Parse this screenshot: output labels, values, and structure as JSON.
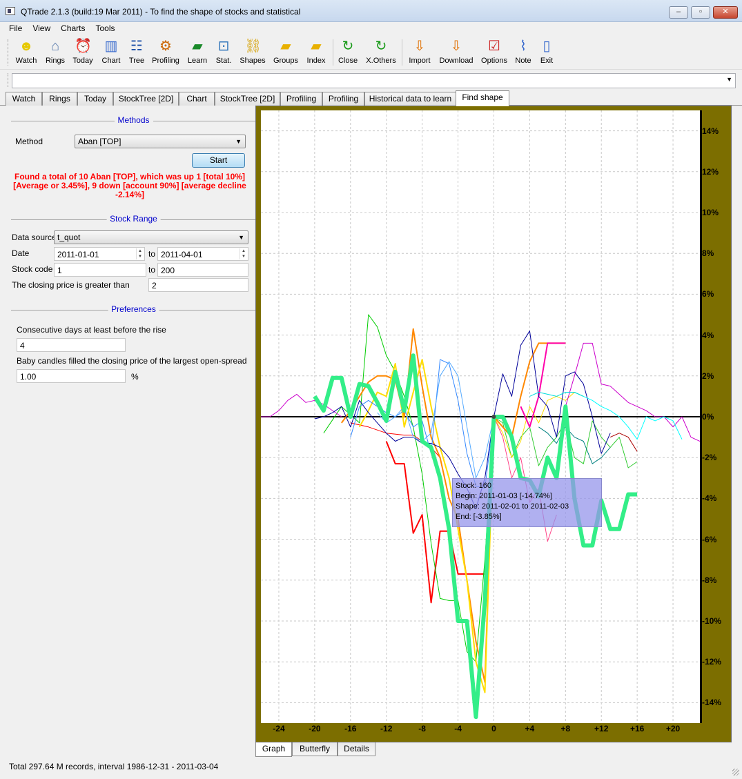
{
  "window": {
    "title": "QTrade 2.1.3 (build:19 Mar 2011) - To find the shape of stocks and statistical"
  },
  "menu": [
    "File",
    "View",
    "Charts",
    "Tools"
  ],
  "toolbar": [
    {
      "label": "Watch",
      "icon": "smiley-icon"
    },
    {
      "label": "Rings",
      "icon": "house-icon"
    },
    {
      "label": "Today",
      "icon": "alarm-clock-icon"
    },
    {
      "label": "Chart",
      "icon": "bar-chart-icon"
    },
    {
      "label": "Tree",
      "icon": "tree-icon"
    },
    {
      "label": "Profiling",
      "icon": "profiling-icon"
    },
    {
      "label": "Learn",
      "icon": "book-icon"
    },
    {
      "label": "Stat.",
      "icon": "magnifier-chart-icon"
    },
    {
      "label": "Shapes",
      "icon": "chain-icon"
    },
    {
      "label": "Groups",
      "icon": "folder-icon"
    },
    {
      "label": "Index",
      "icon": "folder-icon"
    },
    {
      "label": "Close",
      "icon": "refresh-icon"
    },
    {
      "label": "X.Others",
      "icon": "refresh-icon"
    },
    {
      "label": "Import",
      "icon": "import-icon"
    },
    {
      "label": "Download",
      "icon": "download-icon"
    },
    {
      "label": "Options",
      "icon": "checklist-icon"
    },
    {
      "label": "Note",
      "icon": "paperclip-icon"
    },
    {
      "label": "Exit",
      "icon": "door-exit-icon"
    }
  ],
  "tabs": [
    {
      "label": "Watch",
      "active": false
    },
    {
      "label": "Rings",
      "active": false
    },
    {
      "label": "Today",
      "active": false
    },
    {
      "label": "StockTree [2D]",
      "active": false
    },
    {
      "label": "Chart",
      "active": false
    },
    {
      "label": "StockTree [2D]",
      "active": false
    },
    {
      "label": "Profiling",
      "active": false
    },
    {
      "label": "Profiling",
      "active": false
    },
    {
      "label": "Historical data to learn",
      "active": false
    },
    {
      "label": "Find shape",
      "active": true
    }
  ],
  "methods": {
    "section": "Methods",
    "method_label": "Method",
    "method_value": "Aban [TOP]",
    "start_label": "Start",
    "result": "Found a total of 10 Aban [TOP], which was up 1 [total 10%] [Average or 3.45%], 9 down [account 90%] [average decline -2.14%]"
  },
  "stock_range": {
    "section": "Stock Range",
    "data_source_label": "Data source",
    "data_source_value": "t_quot",
    "date_label": "Date",
    "date_from": "2011-01-01",
    "to1": "to",
    "date_to": "2011-04-01",
    "code_label": "Stock code",
    "code_from": "1",
    "to2": "to",
    "code_to": "200",
    "closing_label": "The closing price is greater than",
    "closing_value": "2"
  },
  "preferences": {
    "section": "Preferences",
    "consec_label": "Consecutive days at least before the rise",
    "consec_value": "4",
    "baby_label": "Baby candles filled the closing price of the largest open-spread",
    "baby_value": "1.00",
    "pct": "%"
  },
  "chart_data": {
    "type": "line",
    "xticks": [
      "-24",
      "-20",
      "-16",
      "-12",
      "-8",
      "-4",
      "0",
      "+4",
      "+8",
      "+12",
      "+16",
      "+20"
    ],
    "yticks": [
      "14%",
      "12%",
      "10%",
      "8%",
      "6%",
      "4%",
      "2%",
      "0%",
      "-2%",
      "-4%",
      "-6%",
      "-8%",
      "-10%",
      "-12%",
      "-14%"
    ],
    "xlim": [
      -26,
      23
    ],
    "ylim": [
      -15,
      15
    ],
    "grid": true,
    "series": [
      {
        "color": "#ff0000",
        "width": 2,
        "x": [
          -12,
          -11,
          -10,
          -9,
          -8,
          -7,
          -6,
          -5,
          -4,
          -3,
          -2,
          -1,
          0
        ],
        "y": [
          -1.2,
          -2.3,
          -2.3,
          -5.7,
          -4.8,
          -9.1,
          -5.6,
          -5.6,
          -7.7,
          -7.7,
          -7.7,
          -7.7,
          0
        ]
      },
      {
        "color": "#ff4488",
        "width": 1,
        "x": [
          0,
          1,
          2,
          3,
          4,
          5,
          6,
          7
        ],
        "y": [
          0,
          -1.0,
          -3.0,
          -2.0,
          -4.2,
          -3.5,
          -6.1,
          -4.8
        ]
      },
      {
        "color": "#ff0000",
        "width": 1,
        "x": [
          -16,
          -14,
          -12,
          -10,
          -9,
          -8,
          -7,
          -6
        ],
        "y": [
          -0.3,
          -0.5,
          -0.8,
          -0.9,
          -0.9,
          -1.2,
          -1.5,
          -2.0
        ]
      },
      {
        "color": "#00cc00",
        "width": 1,
        "x": [
          -19,
          -17,
          -15,
          -14,
          -13,
          -12,
          -11,
          -10,
          -9,
          -8,
          -7,
          -6,
          -5,
          -4,
          -3,
          -2,
          -1,
          0
        ],
        "y": [
          -0.8,
          0.5,
          -0.3,
          5.0,
          4.4,
          3.0,
          2.2,
          1.0,
          -0.5,
          -2.8,
          -6.2,
          -8.9,
          -9.0,
          -9.0,
          -11.5,
          -12.0,
          -7.0,
          0
        ]
      },
      {
        "color": "#33cc33",
        "width": 1,
        "x": [
          0,
          1,
          2,
          3,
          4,
          5,
          6,
          7,
          8,
          9,
          10,
          11,
          12,
          13,
          14,
          15,
          16
        ],
        "y": [
          0,
          -0.3,
          -2.0,
          -1.0,
          -0.5,
          -2.4,
          -1.5,
          -1.0,
          -0.2,
          -2.0,
          -2.3,
          -0.2,
          -1.0,
          -1.5,
          -1.0,
          -2.5,
          -2.2
        ]
      },
      {
        "color": "#ff8800",
        "width": 2,
        "x": [
          -17,
          -16,
          -15,
          -14,
          -13,
          -12,
          -11,
          -10,
          -9,
          -8,
          -7,
          -6,
          -5,
          -4,
          -3,
          -2,
          -1,
          0
        ],
        "y": [
          -0.3,
          0.3,
          1.0,
          1.7,
          2.0,
          2.0,
          1.8,
          0.0,
          4.3,
          1.5,
          -1.0,
          -2.0,
          -4.0,
          -5.0,
          -8.0,
          -11.0,
          -13.0,
          0
        ]
      },
      {
        "color": "#ff8800",
        "width": 2,
        "x": [
          0,
          1,
          2,
          3,
          4,
          5,
          6,
          7,
          8
        ],
        "y": [
          0,
          -0.5,
          -1.0,
          1.0,
          2.7,
          3.6,
          3.6,
          3.6,
          3.6
        ]
      },
      {
        "color": "#ffdd00",
        "width": 2,
        "x": [
          -15,
          -14,
          -13,
          -12,
          -11,
          -10,
          -9,
          -8,
          -7,
          -6,
          -5,
          -4,
          -3,
          -2,
          -1,
          0
        ],
        "y": [
          -0.5,
          0.3,
          1.2,
          1.0,
          2.6,
          -0.5,
          1.2,
          2.8,
          0.5,
          -1.5,
          -3.0,
          -5.5,
          -8.0,
          -12.0,
          -13.5,
          0
        ]
      },
      {
        "color": "#ffdd00",
        "width": 1,
        "x": [
          0,
          1,
          2,
          3,
          4,
          5,
          6,
          7,
          8,
          9,
          10
        ],
        "y": [
          0,
          -0.8,
          -2.0,
          -1.2,
          0.5,
          -0.3,
          0.8,
          1.0,
          0.8,
          1.2,
          1.0
        ]
      },
      {
        "color": "#ff00aa",
        "width": 2,
        "x": [
          3,
          4,
          5,
          6,
          7,
          8
        ],
        "y": [
          0.5,
          -0.5,
          1.0,
          3.6,
          3.6,
          3.6
        ]
      },
      {
        "color": "#cc00cc",
        "width": 1,
        "x": [
          -26,
          -25,
          -24,
          -23,
          -22,
          -21,
          -20,
          -19,
          -18,
          -17
        ],
        "y": [
          0.0,
          0.0,
          0.3,
          0.8,
          1.1,
          0.7,
          0.8,
          0.6,
          0.3,
          0.0
        ]
      },
      {
        "color": "#cc00cc",
        "width": 1,
        "x": [
          8,
          9,
          10,
          11,
          12,
          13,
          14,
          15,
          16,
          17,
          18,
          19,
          20,
          21,
          22,
          23
        ],
        "y": [
          0.5,
          2.0,
          3.6,
          3.6,
          1.6,
          1.5,
          1.1,
          0.7,
          0.5,
          0.3,
          0.0,
          0.0,
          -0.5,
          0.0,
          -1.0,
          -1.2
        ]
      },
      {
        "color": "#000099",
        "width": 1,
        "x": [
          -20,
          -19,
          -18,
          -17,
          -16,
          -15,
          -14,
          -13,
          -12,
          -11,
          -10,
          -9,
          -8,
          -7,
          -6,
          -5,
          -4,
          -3,
          -2,
          -1,
          0
        ],
        "y": [
          -0.1,
          0.0,
          0.2,
          0.5,
          -0.5,
          0.8,
          0.2,
          -0.3,
          -0.8,
          -1.2,
          -1.0,
          -1.0,
          -1.3,
          -1.3,
          -1.5,
          -2.0,
          -2.8,
          -3.5,
          -4.5,
          -3.0,
          0
        ]
      },
      {
        "color": "#000099",
        "width": 1,
        "x": [
          0,
          1,
          2,
          3,
          4,
          5,
          6,
          7,
          8,
          9,
          10,
          11,
          12,
          13
        ],
        "y": [
          0,
          2.1,
          1.0,
          3.5,
          4.2,
          1.0,
          0.5,
          -1.0,
          2.0,
          2.2,
          1.6,
          0.0,
          -1.8,
          -0.8
        ]
      },
      {
        "color": "#3388ff",
        "width": 1,
        "x": [
          -16,
          -15,
          -14,
          -13,
          -12,
          -11,
          -10,
          -9,
          -8,
          -7,
          -6,
          -5,
          -4,
          -3,
          -2,
          -1,
          0
        ],
        "y": [
          -1.0,
          0.5,
          0.8,
          0.5,
          0.2,
          0.0,
          0.3,
          -0.5,
          -0.2,
          -1.8,
          2.8,
          2.6,
          0.8,
          -1.8,
          -3.4,
          -3.5,
          0
        ]
      },
      {
        "color": "#55aaff",
        "width": 1,
        "x": [
          -13,
          -12,
          -11,
          -10,
          -9,
          -8,
          -7,
          -6,
          -5,
          -4,
          -3,
          -2,
          -1,
          0
        ],
        "y": [
          0.2,
          -0.3,
          0.0,
          0.5,
          -1.0,
          -1.2,
          -0.8,
          2.0,
          2.7,
          2.0,
          -0.5,
          -3.0,
          -2.0,
          0
        ]
      },
      {
        "color": "#00ffff",
        "width": 1,
        "x": [
          9,
          10,
          11,
          12,
          13,
          14,
          15,
          16,
          17,
          18,
          19,
          20,
          21
        ],
        "y": [
          1.2,
          1.0,
          0.8,
          0.5,
          0.3,
          0.0,
          -0.5,
          -1.1,
          0.0,
          -0.2,
          0.0,
          -0.2,
          -1.1
        ]
      },
      {
        "color": "#00dddd",
        "width": 1,
        "x": [
          4,
          5,
          6,
          7,
          8,
          9,
          10
        ],
        "y": [
          1.0,
          1.2,
          1.1,
          1.0,
          1.2,
          1.2,
          1.0
        ]
      },
      {
        "color": "#008080",
        "width": 1,
        "x": [
          5,
          6,
          7,
          8,
          9,
          10,
          11,
          12,
          13
        ],
        "y": [
          -0.5,
          -0.8,
          -1.3,
          -0.5,
          -1.0,
          -1.2,
          -2.3,
          -2.0,
          -1.5
        ]
      },
      {
        "color": "#aa0000",
        "width": 1,
        "x": [
          13,
          14,
          15,
          16
        ],
        "y": [
          -1.0,
          -0.8,
          -1.0,
          -1.7
        ]
      },
      {
        "color": "#33ee88",
        "width": 6,
        "x": [
          -20,
          -19,
          -18,
          -17,
          -16,
          -15,
          -14,
          -13,
          -12,
          -11,
          -10,
          -9,
          -8,
          -7,
          -6,
          -5,
          -4,
          -3,
          -2,
          -1,
          0,
          1,
          2,
          3,
          4,
          5,
          6,
          7,
          8,
          9,
          10,
          11,
          12,
          13,
          14,
          15,
          16
        ],
        "y": [
          1.0,
          0.3,
          1.9,
          1.9,
          0.0,
          1.6,
          1.5,
          0.7,
          -0.2,
          2.2,
          0.3,
          3.0,
          -1.2,
          -1.5,
          -3.0,
          -5.5,
          -10.0,
          -10.0,
          -14.7,
          -9.0,
          0.0,
          0.0,
          -1.0,
          -3.0,
          -3.1,
          -3.9,
          -2.0,
          -3.0,
          0.5,
          -4.0,
          -6.3,
          -6.3,
          -4.1,
          -5.5,
          -5.5,
          -3.8,
          -3.8
        ]
      }
    ]
  },
  "tooltip": {
    "stock": "Stock: 160",
    "begin": "Begin: 2011-01-03 [-14.74%]",
    "shape": "Shape: 2011-02-01 to 2011-02-03",
    "end": "End:  [-3.85%]"
  },
  "bottom_tabs": [
    {
      "label": "Graph",
      "active": true
    },
    {
      "label": "Butterfly",
      "active": false
    },
    {
      "label": "Details",
      "active": false
    }
  ],
  "status": "Total 297.64 M records, interval 1986-12-31 - 2011-03-04"
}
